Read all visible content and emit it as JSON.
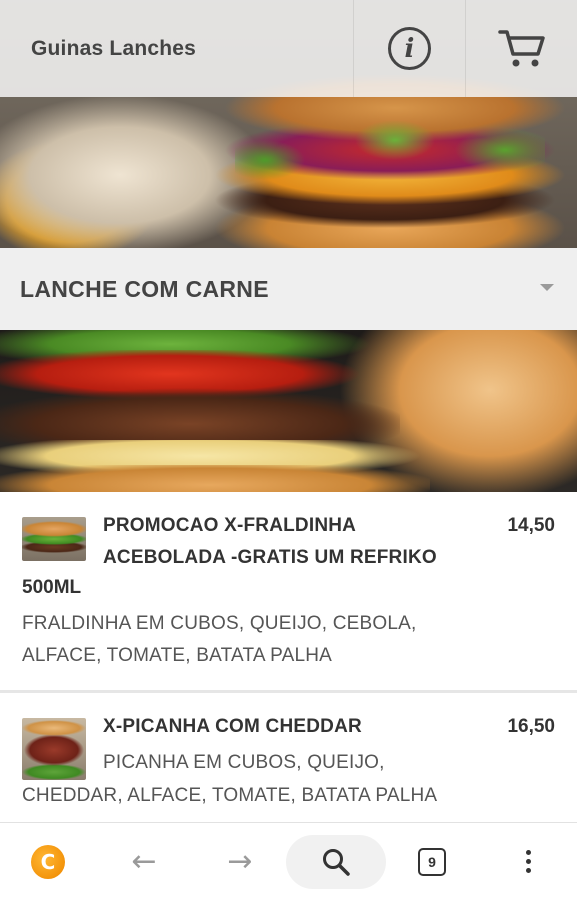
{
  "header": {
    "title": "Guinas Lanches",
    "info_icon": "info-icon",
    "cart_icon": "cart-icon"
  },
  "category": {
    "selected": "LANCHE COM CARNE",
    "icon": "chevron-down-icon"
  },
  "products": [
    {
      "title_line1": "PROMOCAO X-FRALDINHA",
      "title_line2": "ACEBOLADA -GRATIS UM REFRIKO",
      "title_line3": "500ML",
      "price": "14,50",
      "description_line1": "FRALDINHA EM CUBOS, QUEIJO, CEBOLA,",
      "description_line2": "ALFACE, TOMATE, BATATA PALHA"
    },
    {
      "title": "X-PICANHA COM CHEDDAR",
      "price": "16,50",
      "description_line1": "PICANHA EM CUBOS, QUEIJO,",
      "description_line2": "CHEDDAR, ALFACE, TOMATE, BATATA PALHA"
    }
  ],
  "browser_bar": {
    "logo_letter": "C",
    "back_arrow": "←",
    "forward_arrow": "→",
    "tab_count": "9",
    "icons": [
      "browser-logo-icon",
      "back-arrow-icon",
      "forward-arrow-icon",
      "search-icon",
      "tabs-icon",
      "more-menu-icon"
    ]
  },
  "colors": {
    "header_overlay": "#f5f5f5",
    "text_dark": "#444444",
    "category_bg": "#efefef",
    "logo_orange": "#f08a00"
  }
}
